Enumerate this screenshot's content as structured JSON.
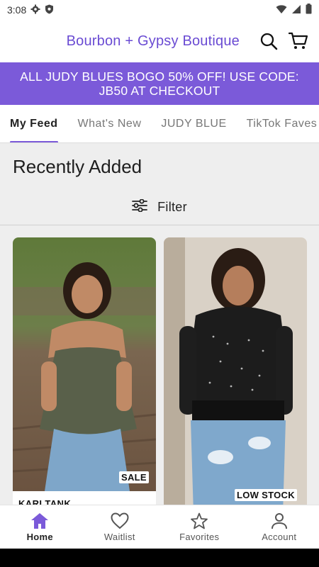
{
  "status_bar": {
    "time": "3:08"
  },
  "header": {
    "brand": "Bourbon + Gypsy Boutique"
  },
  "promo": {
    "line1": "ALL JUDY BLUES BOGO 50% OFF! USE CODE:",
    "line2": "JB50 AT CHECKOUT"
  },
  "tabs": [
    "My Feed",
    "What's New",
    "JUDY BLUE",
    "TikTok Faves"
  ],
  "feed": {
    "section_title": "Recently Added",
    "filter_label": "Filter",
    "products": [
      {
        "name": "KARI TANK",
        "badge": "SALE"
      },
      {
        "name": "",
        "badge": "LOW STOCK"
      }
    ]
  },
  "bottom_nav": [
    {
      "label": "Home",
      "icon": "home-icon"
    },
    {
      "label": "Waitlist",
      "icon": "heart-icon"
    },
    {
      "label": "Favorites",
      "icon": "star-icon"
    },
    {
      "label": "Account",
      "icon": "account-icon"
    }
  ],
  "colors": {
    "accent": "#7b5ad9",
    "brand_text": "#6a4bd3",
    "feed_bg": "#eeeeee"
  }
}
